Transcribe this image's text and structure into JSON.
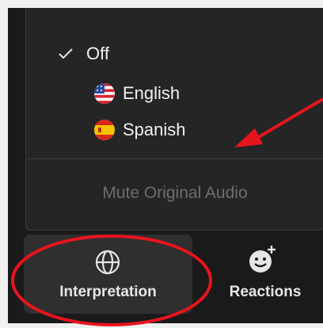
{
  "menu": {
    "items": [
      {
        "label": "Off",
        "checked": true,
        "icon": "checkmark-icon"
      },
      {
        "label": "English",
        "checked": false,
        "icon": "us-flag-icon"
      },
      {
        "label": "Spanish",
        "checked": false,
        "icon": "spain-flag-icon"
      }
    ],
    "mute_label": "Mute Original Audio"
  },
  "toolbar": {
    "interpretation_label": "Interpretation",
    "interpretation_icon": "globe-icon",
    "reactions_label": "Reactions",
    "reactions_icon": "add-reaction-icon"
  },
  "annotations": {
    "arrow_color": "#e8141c",
    "circle_color": "#e8141c"
  },
  "colors": {
    "menu_background": "#252525",
    "toolbar_background": "#1a1a1a",
    "disabled_text": "#6d6d6d"
  }
}
